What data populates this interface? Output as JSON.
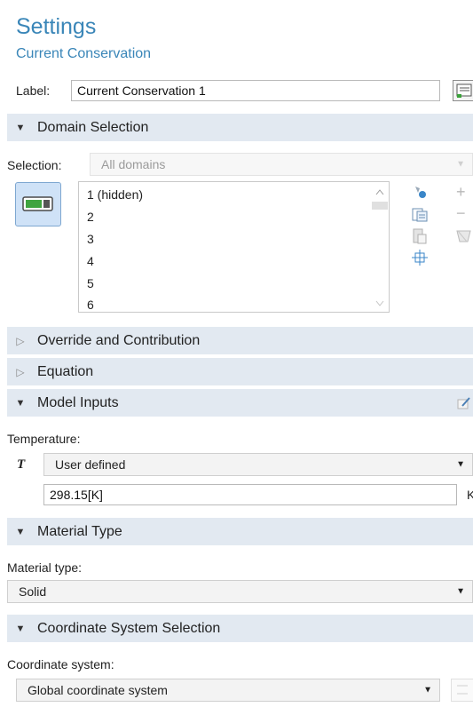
{
  "header": {
    "title": "Settings",
    "subtitle": "Current Conservation"
  },
  "label_row": {
    "label": "Label:",
    "value": "Current Conservation 1"
  },
  "sections": {
    "domain_selection": "Domain Selection",
    "override": "Override and Contribution",
    "equation": "Equation",
    "model_inputs": "Model Inputs",
    "material_type": "Material Type",
    "coordinate_system": "Coordinate System Selection"
  },
  "domain_selection": {
    "selection_label": "Selection:",
    "selection_value": "All domains",
    "items": [
      "1 (hidden)",
      "2",
      "3",
      "4",
      "5",
      "6"
    ]
  },
  "model_inputs": {
    "temperature_label": "Temperature:",
    "symbol": "T",
    "source": "User defined",
    "value": "298.15[K]",
    "unit": "K"
  },
  "material_type": {
    "label": "Material type:",
    "value": "Solid"
  },
  "coordinate_system": {
    "label": "Coordinate system:",
    "value": "Global coordinate system"
  },
  "colors": {
    "title": "#3a86b8",
    "section_bg": "#e2e9f1"
  }
}
